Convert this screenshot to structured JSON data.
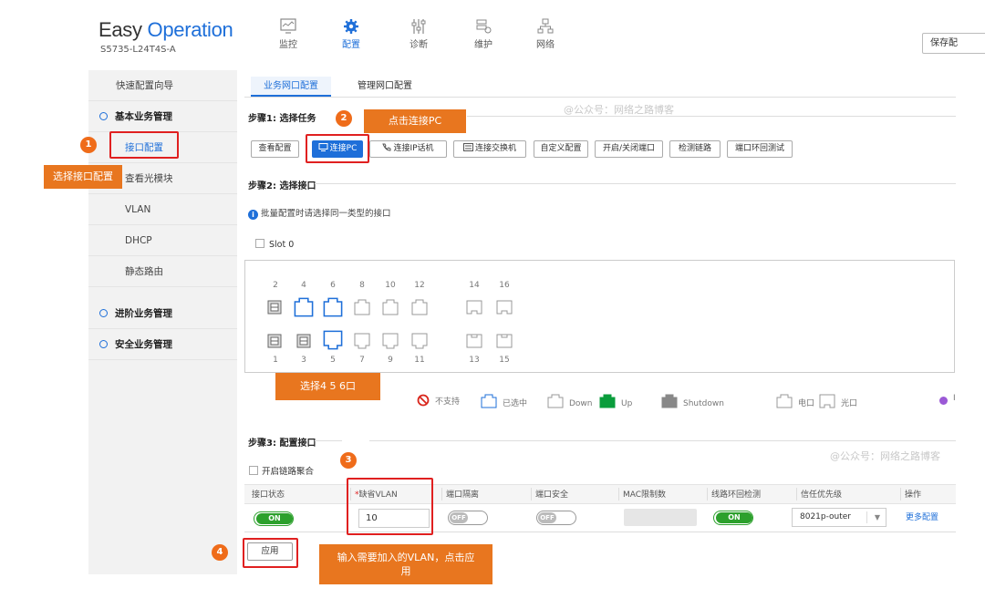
{
  "header": {
    "logo_part1": "Easy",
    "logo_part2": "Operation",
    "model": "S5735-L24T4S-A",
    "nav": [
      "监控",
      "配置",
      "诊断",
      "维护",
      "网络"
    ],
    "save_label": "保存配"
  },
  "sidebar": {
    "items": [
      "快速配置向导",
      "基本业务管理",
      "接口配置",
      "查看光模块",
      "VLAN",
      "DHCP",
      "静态路由",
      "进阶业务管理",
      "安全业务管理"
    ]
  },
  "tabs": [
    "业务网口配置",
    "管理网口配置"
  ],
  "step1": {
    "title": "步骤1: 选择任务",
    "buttons": [
      "查看配置",
      "连接PC",
      "连接IP话机",
      "连接交换机",
      "自定义配置",
      "开启/关闭端口",
      "检测链路",
      "端口环回测试"
    ]
  },
  "step2": {
    "title": "步骤2: 选择接口",
    "hint": "批量配置时请选择同一类型的接口",
    "slot_label": "Slot 0",
    "top_port_numbers": [
      "2",
      "4",
      "6",
      "8",
      "10",
      "12",
      "14",
      "16"
    ],
    "bottom_port_numbers": [
      "1",
      "3",
      "5",
      "7",
      "9",
      "11",
      "13",
      "15"
    ],
    "legend": [
      "不支持",
      "已选中",
      "Down",
      "Up",
      "Shutdown",
      "电口",
      "光口"
    ]
  },
  "step3": {
    "title": "步骤3: 配置接口",
    "agg_label": "开启链路聚合",
    "headers": [
      "接口状态",
      "缺省VLAN",
      "端口隔离",
      "端口安全",
      "MAC限制数",
      "线路环回检测",
      "信任优先级",
      "操作"
    ],
    "required_mark": "*",
    "row": {
      "status": "ON",
      "vlan": "10",
      "isolate": "OFF",
      "security": "OFF",
      "loop": "ON",
      "trust": "8021p-outer",
      "more": "更多配置"
    },
    "apply_label": "应用"
  },
  "annotations": {
    "badges": [
      "1",
      "2",
      "3",
      "4"
    ],
    "notes": [
      "选择接口配置",
      "点击连接PC",
      "选择4 5 6口",
      "输入需要加入的VLAN，点击应用"
    ]
  },
  "watermark": "@公众号：网络之路博客",
  "colors": {
    "accent": "#1e6fd9",
    "annotation": "#e8761f",
    "highlight_border": "#e02020",
    "up_green": "#0a9d3c"
  }
}
